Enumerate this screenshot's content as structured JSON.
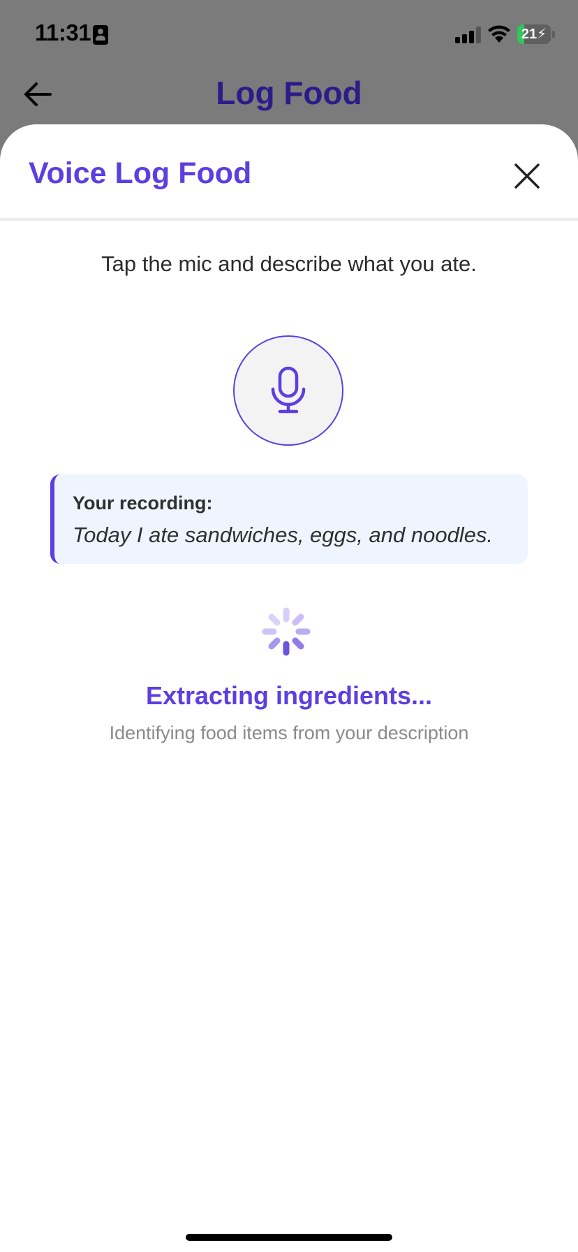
{
  "status_bar": {
    "time": "11:31",
    "battery": "21",
    "battery_level_percent": 21,
    "icons": [
      "id-card-icon",
      "signal-icon",
      "wifi-icon",
      "battery-charging-icon"
    ]
  },
  "background_screen": {
    "title": "Log Food",
    "back_icon": "arrow-left-icon"
  },
  "sheet": {
    "title": "Voice Log Food",
    "close_icon": "close-icon",
    "instruction": "Tap the mic and describe what you ate.",
    "mic_icon": "microphone-icon",
    "recording": {
      "label": "Your recording:",
      "text": "Today I ate sandwiches, eggs, and noodles."
    },
    "status": {
      "title": "Extracting ingredients...",
      "subtitle": "Identifying food items from your description",
      "spinner_icon": "loading-spinner-icon"
    }
  },
  "colors": {
    "accent": "#5b3fe0",
    "background_title": "#2b1c8a",
    "overlay": "#7b7b7b",
    "recording_card_bg": "#eef5ff",
    "subtitle_gray": "#8a8a8a"
  }
}
